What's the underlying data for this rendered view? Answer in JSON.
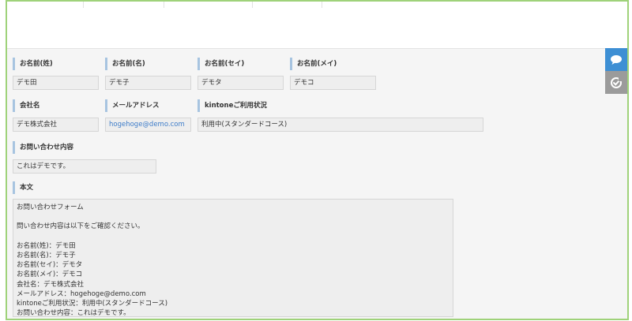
{
  "fields": {
    "last_name": {
      "label": "お名前(姓)",
      "value": "デモ田"
    },
    "first_name": {
      "label": "お名前(名)",
      "value": "デモ子"
    },
    "last_name_kana": {
      "label": "お名前(セイ)",
      "value": "デモタ"
    },
    "first_name_kana": {
      "label": "お名前(メイ)",
      "value": "デモコ"
    },
    "company": {
      "label": "会社名",
      "value": "デモ株式会社"
    },
    "email": {
      "label": "メールアドレス",
      "value": "hogehoge@demo.com"
    },
    "kintone_status": {
      "label": "kintoneご利用状況",
      "value": "利用中(スタンダードコース)"
    },
    "inquiry": {
      "label": "お問い合わせ内容",
      "value": "これはデモです。"
    }
  },
  "body": {
    "label": "本文",
    "lines": [
      "お問い合わせフォーム",
      "",
      "問い合わせ内容は以下をご確認ください。",
      "",
      "お名前(姓)：デモ田",
      "お名前(名)：デモ子",
      "お名前(セイ)：デモタ",
      "お名前(メイ)：デモコ",
      "会社名：デモ株式会社",
      "メールアドレス：hogehoge@demo.com",
      "kintoneご利用状況：利用中(スタンダードコース)",
      "お問い合わせ内容：これはデモです。"
    ]
  },
  "side_tabs": [
    {
      "icon": "comment-icon",
      "color": "#3d8fd4"
    },
    {
      "icon": "history-check-icon",
      "color": "#9b9b9b"
    }
  ],
  "colors": {
    "frame_border": "#9fd27a",
    "label_accent": "#a7c4e0",
    "link": "#3d7cc9"
  }
}
